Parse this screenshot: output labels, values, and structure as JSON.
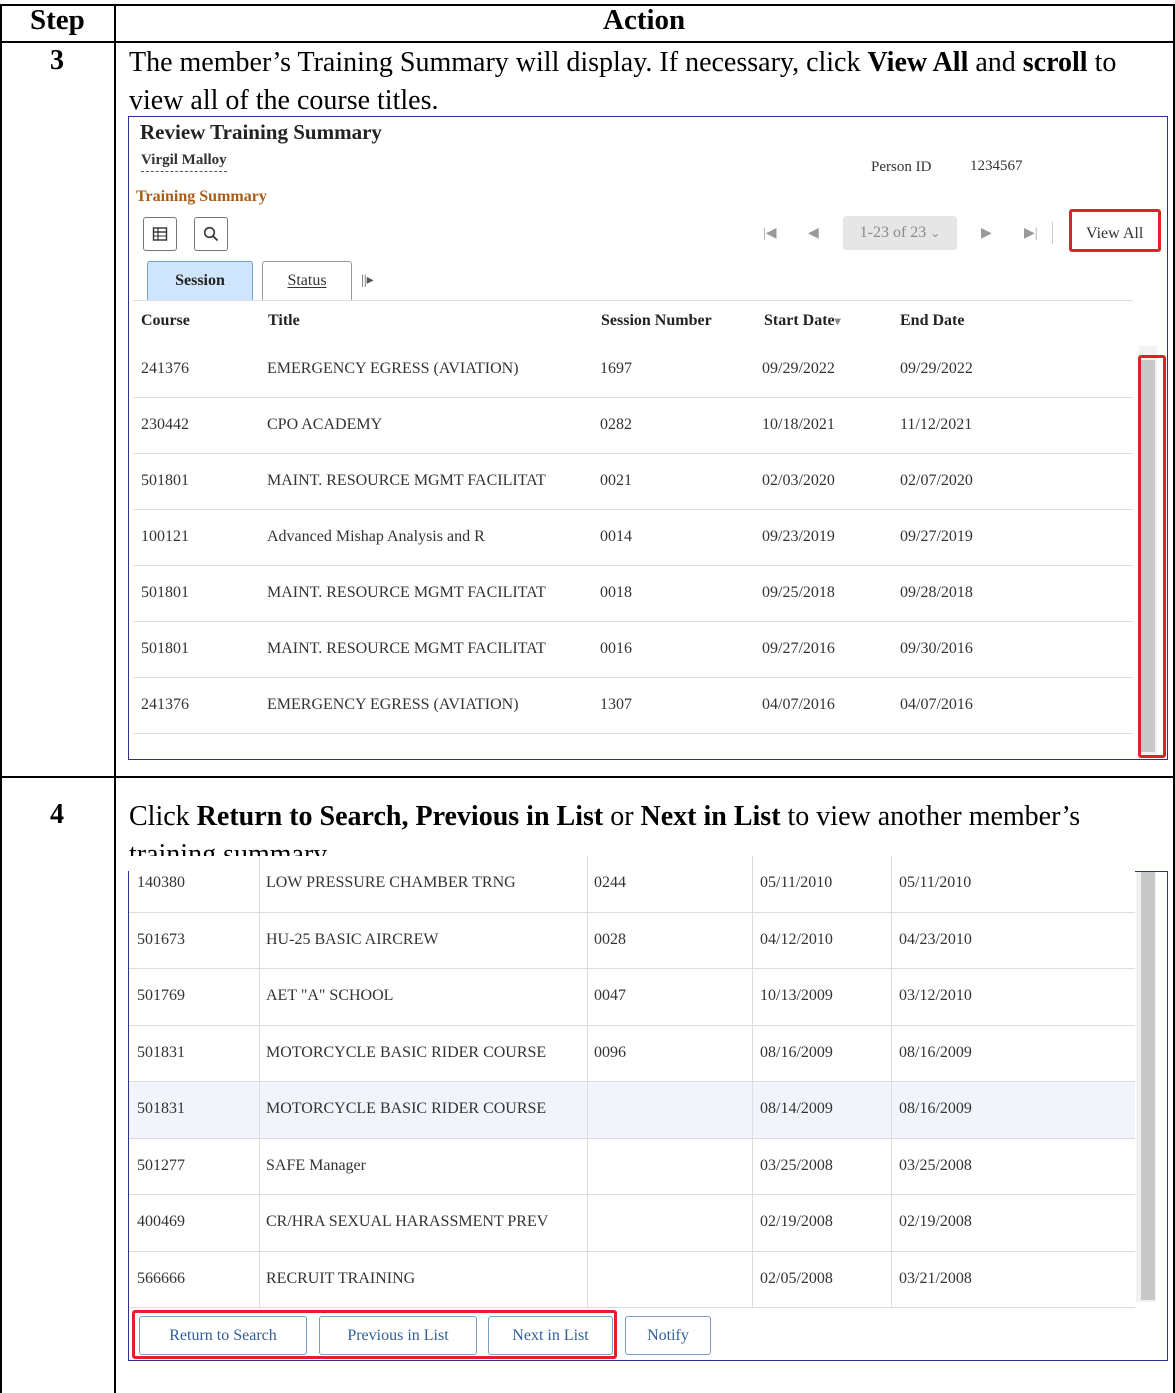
{
  "table_header": {
    "step": "Step",
    "action": "Action"
  },
  "steps": [
    {
      "number": "3",
      "text_parts": [
        {
          "t": "The member’s Training Summary will display.  If necessary, click ",
          "b": false
        },
        {
          "t": "View All",
          "b": true
        },
        {
          "t": " and ",
          "b": false
        },
        {
          "t": "scroll",
          "b": true
        },
        {
          "t": " to view all of the course titles.",
          "b": false
        }
      ]
    },
    {
      "number": "4",
      "text_parts": [
        {
          "t": "Click ",
          "b": false
        },
        {
          "t": "Return to Search, Previous in List",
          "b": true
        },
        {
          "t": " or ",
          "b": false
        },
        {
          "t": "Next in List",
          "b": true
        },
        {
          "t": " to view another member’s training summary.",
          "b": false
        }
      ]
    }
  ],
  "ps_page": {
    "title": "Review Training Summary",
    "person_name": "Virgil Malloy",
    "person_id_label": "Person ID",
    "person_id": "1234567",
    "grid_title": "Training Summary",
    "pagination": {
      "range": "1-23 of 23",
      "view_all": "View All"
    },
    "tabs": [
      "Session",
      "Status"
    ],
    "columns": [
      "Course",
      "Title",
      "Session Number",
      "Start Date",
      "End Date"
    ],
    "rows_top": [
      [
        "241376",
        "EMERGENCY EGRESS (AVIATION)",
        "1697",
        "09/29/2022",
        "09/29/2022"
      ],
      [
        "230442",
        "CPO ACADEMY",
        "0282",
        "10/18/2021",
        "11/12/2021"
      ],
      [
        "501801",
        "MAINT. RESOURCE MGMT FACILITAT",
        "0021",
        "02/03/2020",
        "02/07/2020"
      ],
      [
        "100121",
        "Advanced Mishap Analysis and R",
        "0014",
        "09/23/2019",
        "09/27/2019"
      ],
      [
        "501801",
        "MAINT. RESOURCE MGMT FACILITAT",
        "0018",
        "09/25/2018",
        "09/28/2018"
      ],
      [
        "501801",
        "MAINT. RESOURCE MGMT FACILITAT",
        "0016",
        "09/27/2016",
        "09/30/2016"
      ],
      [
        "241376",
        "EMERGENCY EGRESS (AVIATION)",
        "1307",
        "04/07/2016",
        "04/07/2016"
      ]
    ],
    "rows_bottom": [
      [
        "140380",
        "LOW PRESSURE CHAMBER TRNG",
        "0244",
        "05/11/2010",
        "05/11/2010"
      ],
      [
        "501673",
        "HU-25 BASIC AIRCREW",
        "0028",
        "04/12/2010",
        "04/23/2010"
      ],
      [
        "501769",
        "AET \"A\" SCHOOL",
        "0047",
        "10/13/2009",
        "03/12/2010"
      ],
      [
        "501831",
        "MOTORCYCLE BASIC RIDER COURSE",
        "0096",
        "08/16/2009",
        "08/16/2009"
      ],
      [
        "501831",
        "MOTORCYCLE BASIC RIDER COURSE",
        "",
        "08/14/2009",
        "08/16/2009"
      ],
      [
        "501277",
        "SAFE Manager",
        "",
        "03/25/2008",
        "03/25/2008"
      ],
      [
        "400469",
        "CR/HRA SEXUAL HARASSMENT PREV",
        "",
        "02/19/2008",
        "02/19/2008"
      ],
      [
        "566666",
        "RECRUIT TRAINING",
        "",
        "02/05/2008",
        "03/21/2008"
      ]
    ],
    "buttons": [
      "Return to Search",
      "Previous in List",
      "Next in List",
      "Notify"
    ]
  },
  "icons": [
    "grid-icon",
    "search-icon",
    "first-page-icon",
    "prev-page-icon",
    "next-page-icon",
    "last-page-icon",
    "chevron-down-icon",
    "more-tabs-icon",
    "sort-desc-icon"
  ]
}
